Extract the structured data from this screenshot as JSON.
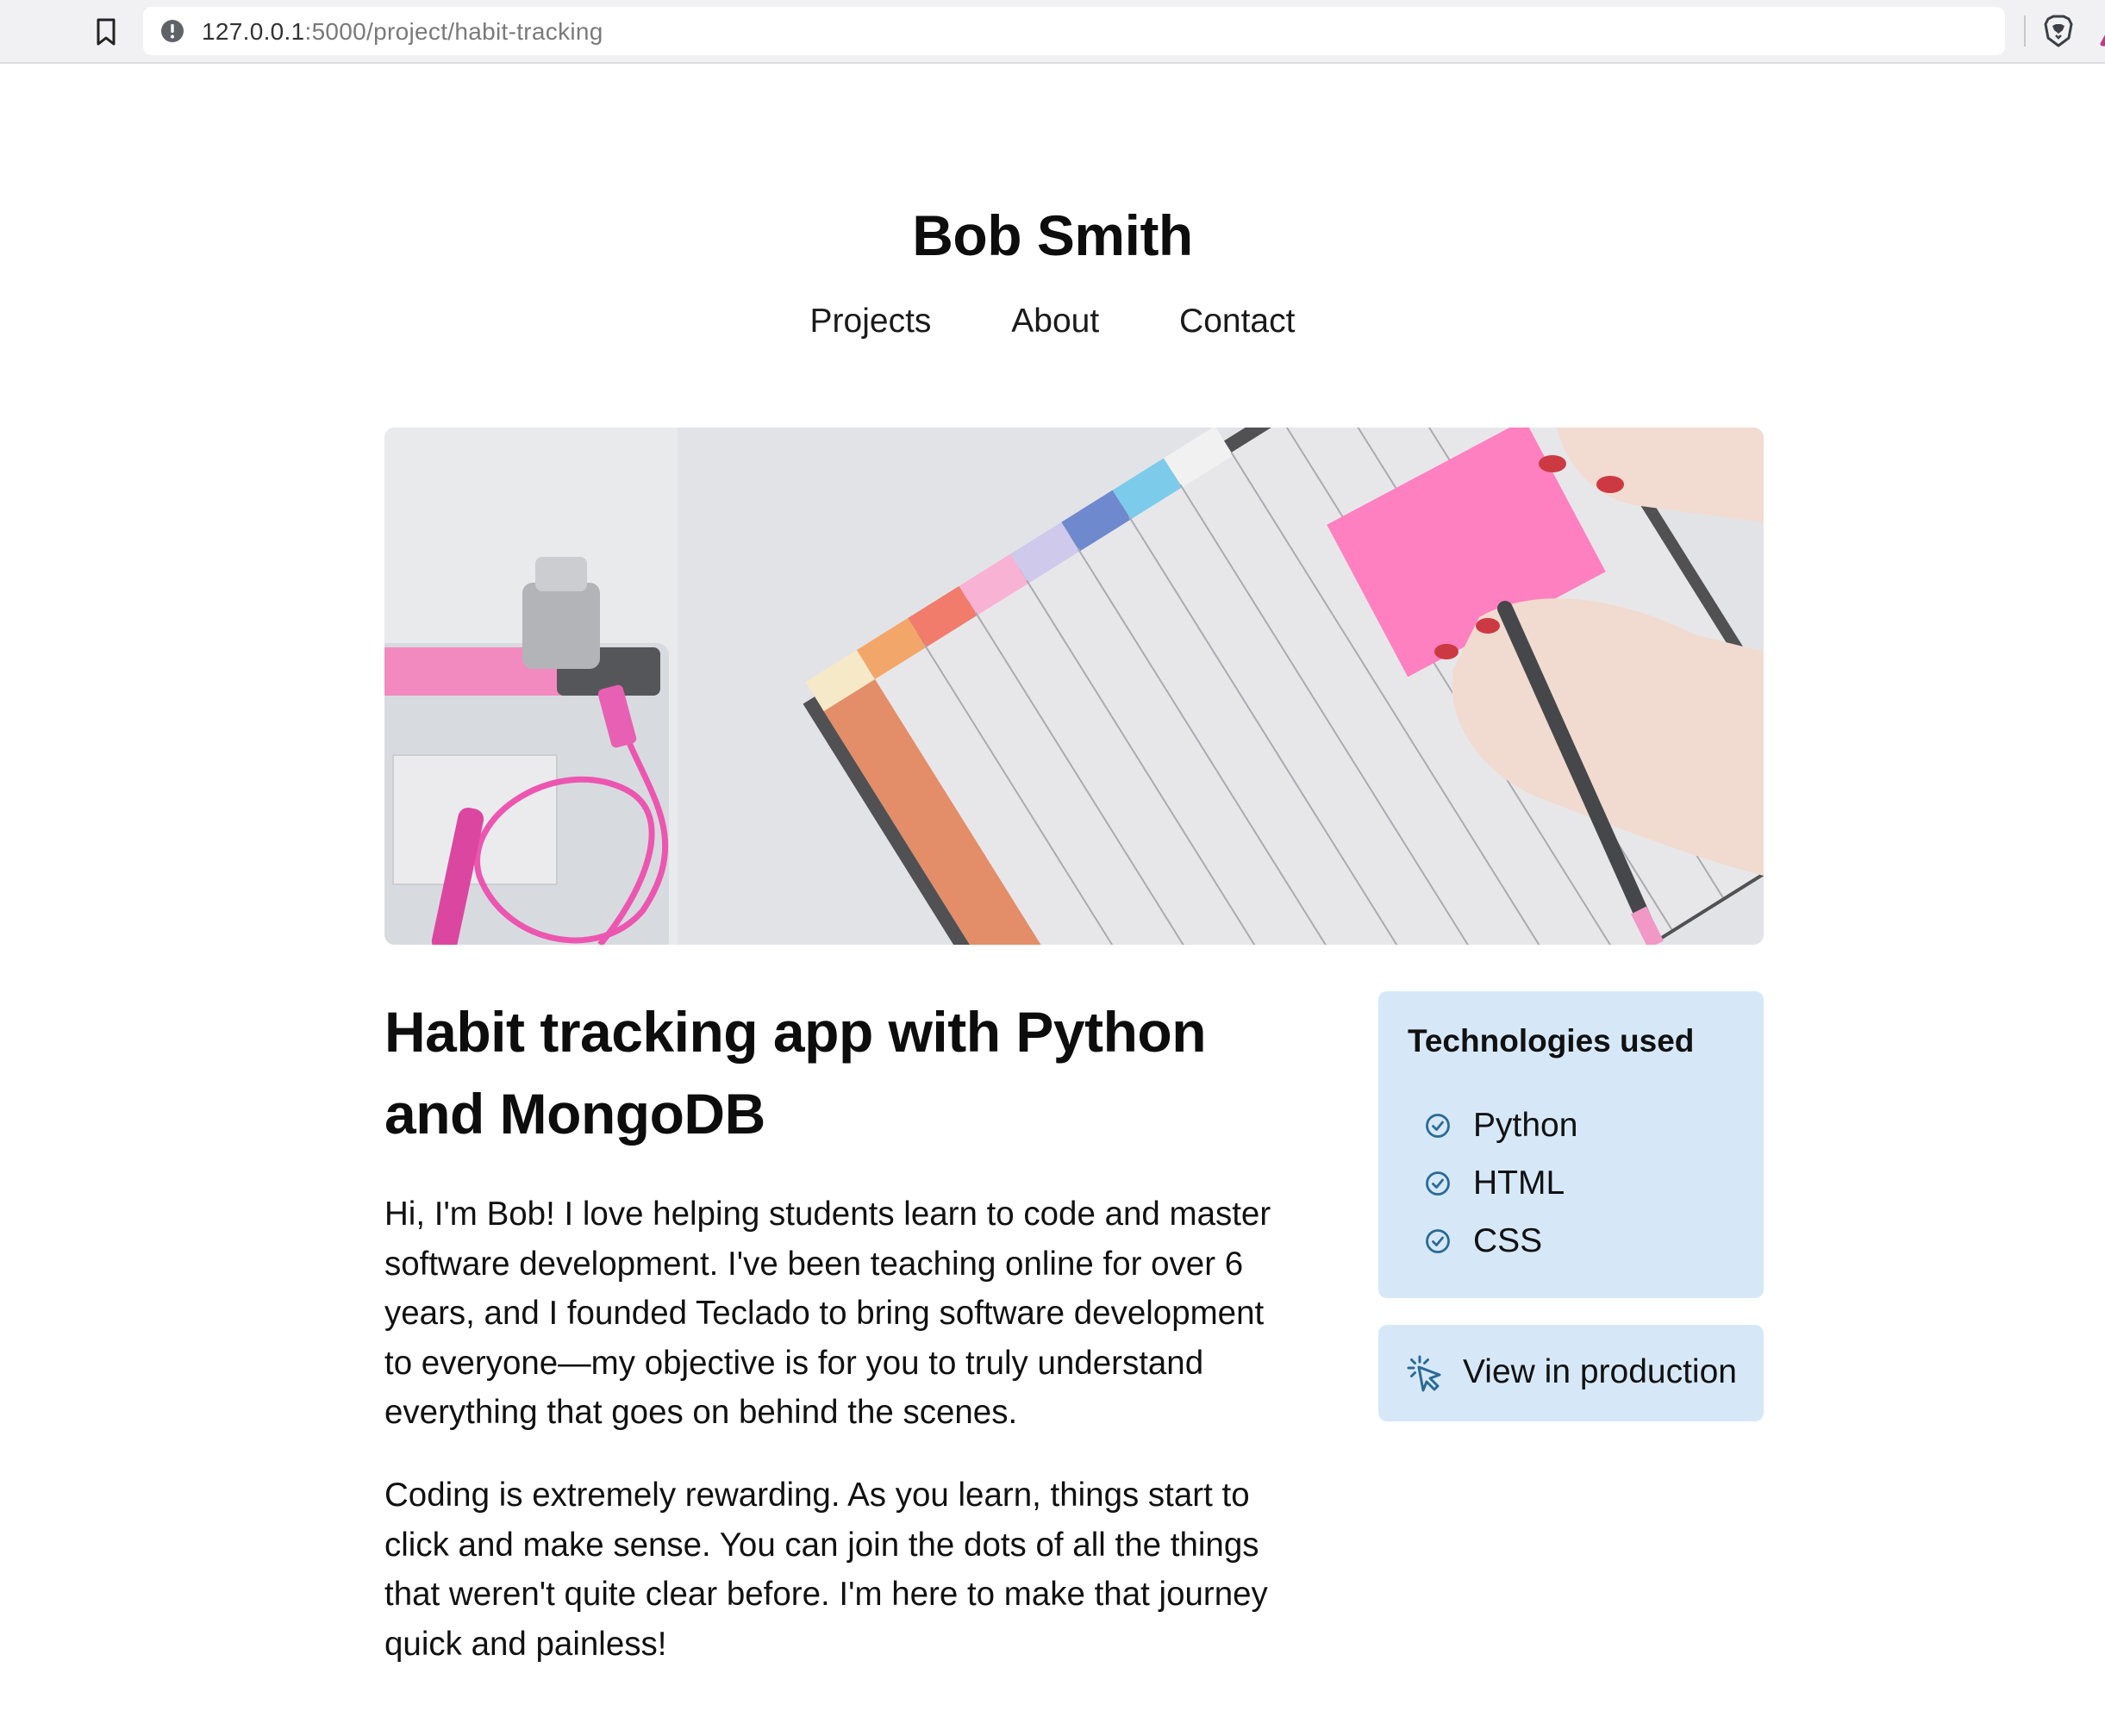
{
  "browser": {
    "url_host": "127.0.0.1",
    "url_path": ":5000/project/habit-tracking"
  },
  "site": {
    "title": "Bob Smith",
    "nav": [
      "Projects",
      "About",
      "Contact"
    ]
  },
  "hero": {
    "icon": "image"
  },
  "article": {
    "title": "Habit tracking app with Python and MongoDB",
    "paragraphs": [
      "Hi, I'm Bob! I love helping students learn to code and master software development. I've been teaching online for over 6 years, and I founded Teclado to bring software development to everyone—my objective is for you to truly understand everything that goes on behind the scenes.",
      "Coding is extremely rewarding. As you learn, things start to click and make sense. You can join the dots of all the things that weren't quite clear before. I'm here to make that journey quick and painless!"
    ]
  },
  "sidebar": {
    "tech_title": "Technologies used",
    "technologies": [
      "Python",
      "HTML",
      "CSS"
    ],
    "production_label": "View in production"
  },
  "colors": {
    "card_background": "#d6e8f8",
    "icon_accent": "#2a6a96"
  }
}
